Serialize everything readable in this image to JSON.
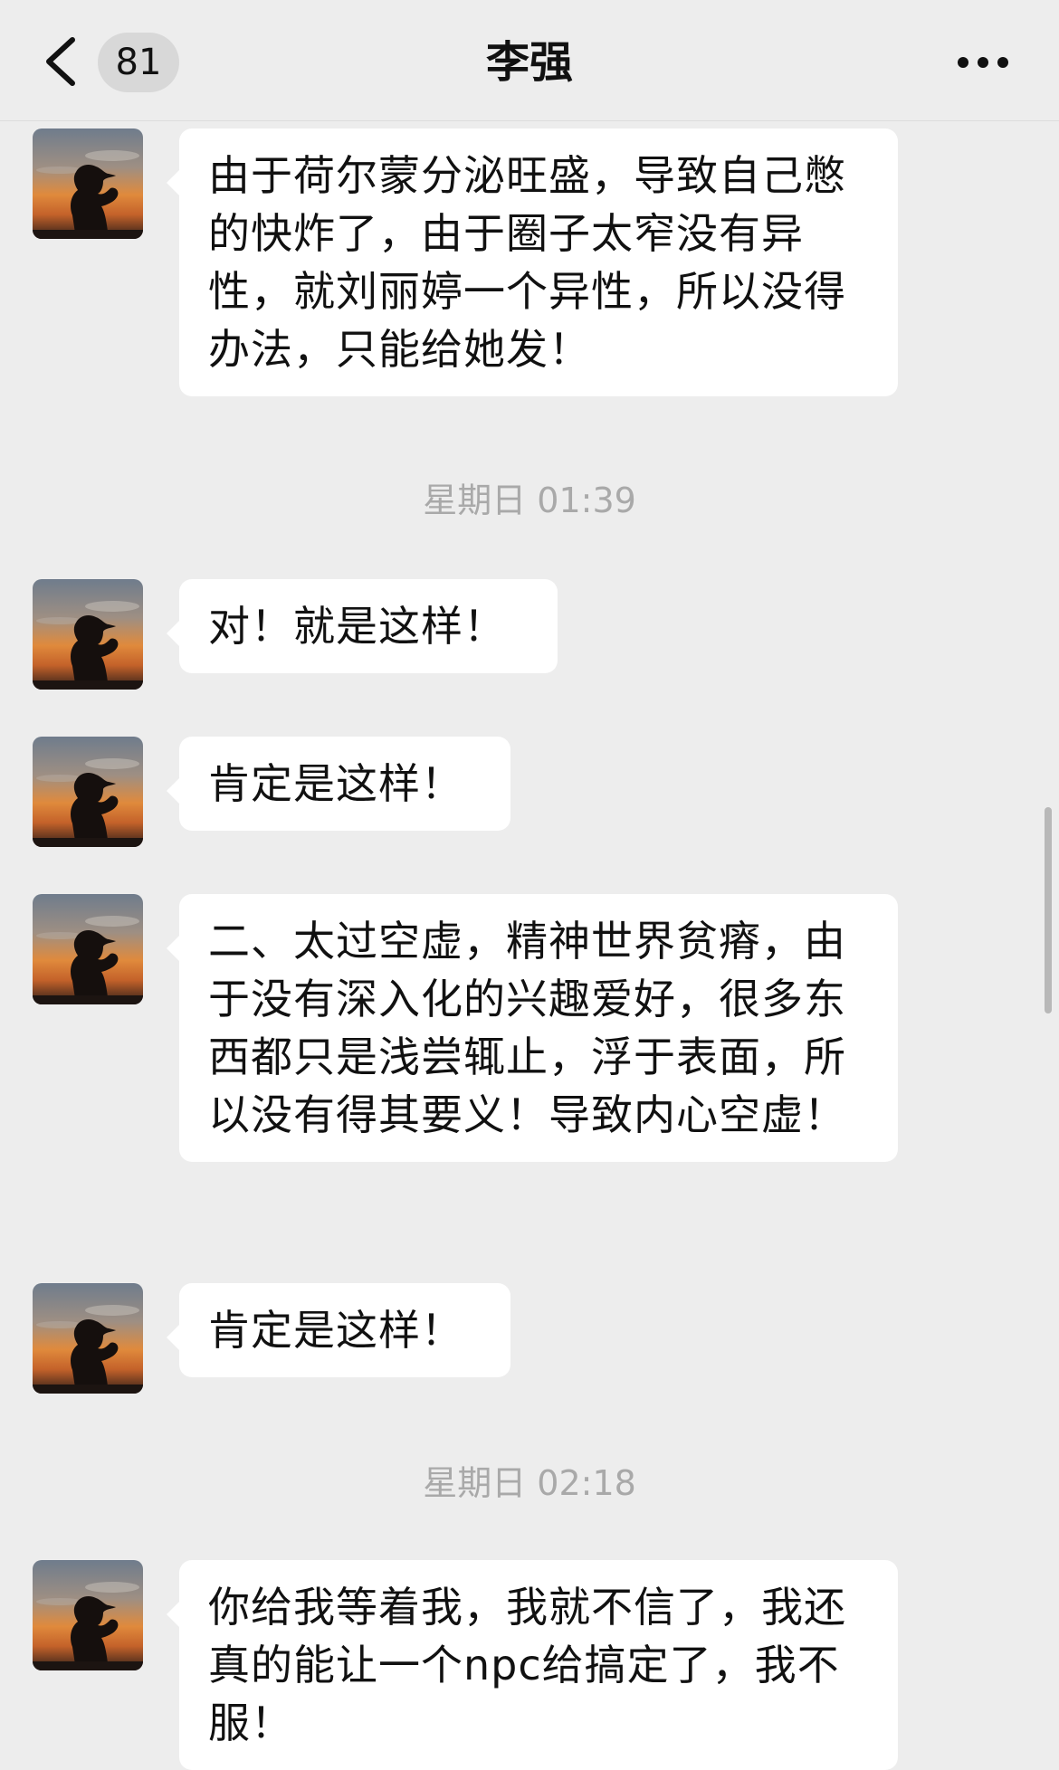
{
  "nav": {
    "back_icon": "chevron-left-icon",
    "unread_count": "81",
    "title": "李强",
    "more_icon": "more-horizontal-icon"
  },
  "messages": [
    {
      "type": "message",
      "text": "由于荷尔蒙分泌旺盛，导致自己憋的快炸了，由于圈子太窄没有异性，就刘丽婷一个异性，所以没得办法，只能给她发！"
    },
    {
      "type": "timestamp",
      "text": "星期日 01:39"
    },
    {
      "type": "message",
      "text": "对！就是这样！"
    },
    {
      "type": "message",
      "text": "肯定是这样！"
    },
    {
      "type": "message",
      "text": "二、太过空虚，精神世界贫瘠，由于没有深入化的兴趣爱好，很多东西都只是浅尝辄止，浮于表面，所以没有得其要义！导致内心空虚！"
    },
    {
      "type": "message",
      "text": "肯定是这样！"
    },
    {
      "type": "timestamp",
      "text": "星期日 02:18"
    },
    {
      "type": "message",
      "text": "你给我等着我，我就不信了，我还真的能让一个npc给搞定了，我不服！"
    }
  ],
  "colors": {
    "background": "#EDEDED",
    "bubble": "#FFFFFF",
    "timestamp": "#A9A9A9"
  }
}
